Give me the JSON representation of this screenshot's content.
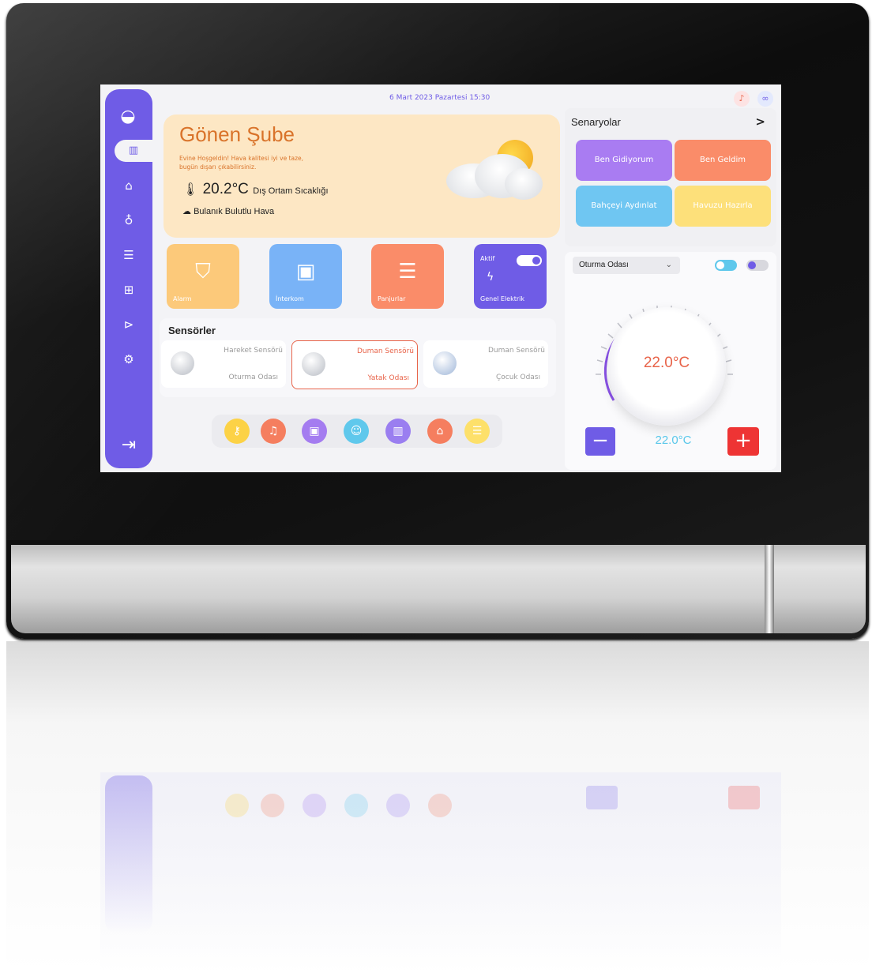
{
  "header": {
    "date_time": "6 Mart 2023 Pazartesi 15:30"
  },
  "weather": {
    "title": "Gönen Şube",
    "welcome_line1": "Evine Hoşgeldin! Hava kalitesi iyi ve taze,",
    "welcome_line2": "bugün dışarı çıkabilirsiniz.",
    "temperature": "20.2°C",
    "temperature_label": "Dış Ortam Sıcaklığı",
    "condition": "Bulanık Bulutlu Hava"
  },
  "tiles": [
    {
      "label": "Alarm",
      "color": "#fcc97a",
      "icon": "shield-icon"
    },
    {
      "label": "İnterkom",
      "color": "#79b3f7",
      "icon": "intercom-icon"
    },
    {
      "label": "Panjurlar",
      "color": "#fa8c69",
      "icon": "blinds-icon"
    },
    {
      "label": "Genel Elektrik",
      "status": "Aktif",
      "color": "#6f5ce6",
      "icon": "lightning-icon"
    }
  ],
  "sensors": {
    "title": "Sensörler",
    "items": [
      {
        "name": "Hareket Sensörü",
        "room": "Oturma Odası",
        "alert": false
      },
      {
        "name": "Duman Sensörü",
        "room": "Yatak Odası",
        "alert": true
      },
      {
        "name": "Duman Sensörü",
        "room": "Çocuk Odası",
        "alert": false
      }
    ]
  },
  "scenarios": {
    "title": "Senaryolar",
    "arrow": ">",
    "items": [
      {
        "label": "Ben Gidiyorum",
        "color": "#a97cf2"
      },
      {
        "label": "Ben Geldim",
        "color": "#fa8c69"
      },
      {
        "label": "Bahçeyi Aydınlat",
        "color": "#6fc6f2"
      },
      {
        "label": "Havuzu Hazırla",
        "color": "#fde07a"
      }
    ]
  },
  "thermostat": {
    "room": "Oturma Odası",
    "current": "22.0°C",
    "setpoint": "22.0°C",
    "minus": "−",
    "plus": "+"
  },
  "dock": [
    {
      "icon": "key-icon",
      "color": "#fcd246"
    },
    {
      "icon": "bell-icon",
      "color": "#f57e5f"
    },
    {
      "icon": "intercom-icon",
      "color": "#a47cf0"
    },
    {
      "icon": "user-icon",
      "color": "#5fc8ec"
    },
    {
      "icon": "curtain-icon",
      "color": "#9a7ef0"
    },
    {
      "icon": "garage-icon",
      "color": "#f57e5f"
    },
    {
      "icon": "more-icon",
      "color": "#fde06a"
    }
  ],
  "sidebar": [
    "logo-icon",
    "dashboard-icon",
    "building-icon",
    "lightbulb-icon",
    "blinds-icon",
    "network-icon",
    "camera-icon",
    "settings-icon",
    "logout-icon"
  ]
}
